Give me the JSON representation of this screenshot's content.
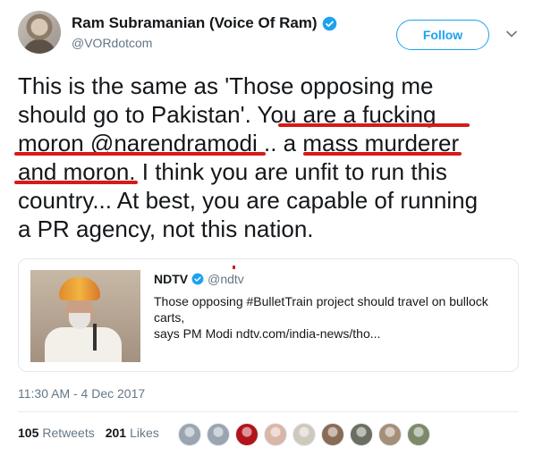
{
  "author": {
    "display_name": "Ram Subramanian (Voice Of Ram)",
    "handle": "@VORdotcom",
    "verified_icon": "verified-badge-icon"
  },
  "follow_label": "Follow",
  "tweet": {
    "segments": [
      "This is the same as 'Those opposing me should go to Pakistan'.",
      "You are a fucking moron @narendramodi",
      "..",
      "a mass murderer and moron",
      ". I think you are unfit to run this country... At best, you are capable of running a PR agency, not this nation."
    ],
    "lines": [
      "This is the same as 'Those opposing me",
      "should go to Pakistan'. You are a fucking",
      "moron @narendramodi .. a mass murderer",
      "and moron. I think you are unfit to run this",
      "country... At best, you are capable of running",
      "a PR agency, not this nation."
    ]
  },
  "quoted": {
    "name": "NDTV",
    "handle": "@ndtv",
    "body_line1": "Those opposing #BulletTrain project should travel on bullock carts,",
    "body_line2": "says PM Modi ndtv.com/india-news/tho..."
  },
  "timestamp": "11:30 AM - 4 Dec 2017",
  "stats": {
    "retweets_count": "105",
    "retweets_label": "Retweets",
    "likes_count": "201",
    "likes_label": "Likes"
  },
  "colors": {
    "accent": "#1da1f2",
    "annotation_red": "#d61a1a",
    "secondary_text": "#657786"
  },
  "likers": [
    {
      "color": "#9aa5b1"
    },
    {
      "color": "#9aa5b1"
    },
    {
      "color": "#b3131b"
    },
    {
      "color": "#d9b6a7"
    },
    {
      "color": "#cfc9bd"
    },
    {
      "color": "#8a6b55"
    },
    {
      "color": "#6b6f62"
    },
    {
      "color": "#a58f78"
    },
    {
      "color": "#7d8a6a"
    }
  ]
}
